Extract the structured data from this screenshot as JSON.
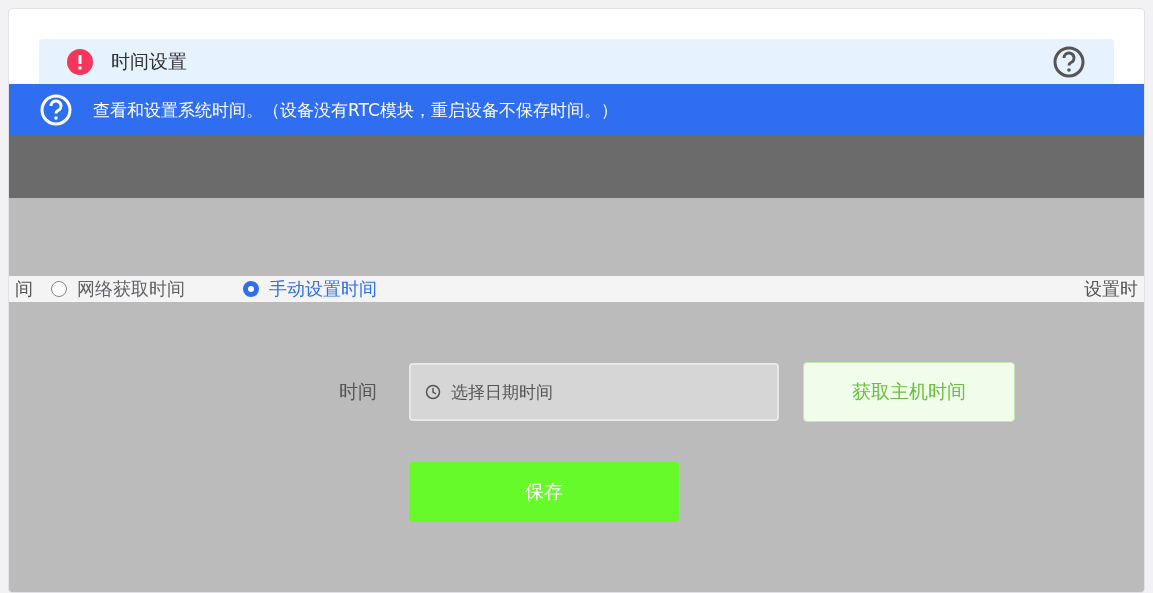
{
  "card": {
    "title": "时间设置"
  },
  "notice": {
    "text": "查看和设置系统时间。（设备没有RTC模块，重启设备不保存时间。）"
  },
  "mode": {
    "left_fragment": "间",
    "right_fragment": "设置时",
    "options": [
      {
        "label": "网络获取时间",
        "selected": false
      },
      {
        "label": "手动设置时间",
        "selected": true
      }
    ]
  },
  "form": {
    "time_label": "时间",
    "time_placeholder": "选择日期时间",
    "host_button": "获取主机时间",
    "save_button": "保存"
  }
}
